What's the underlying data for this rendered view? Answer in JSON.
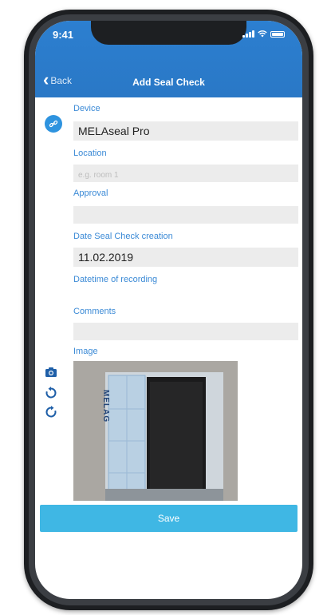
{
  "status_bar": {
    "time": "9:41"
  },
  "nav": {
    "back_label": "Back",
    "title": "Add Seal Check"
  },
  "form": {
    "device": {
      "label": "Device",
      "value": "MELAseal Pro"
    },
    "location": {
      "label": "Location",
      "placeholder": "e.g. room 1",
      "value": ""
    },
    "approval": {
      "label": "Approval",
      "value": ""
    },
    "date_seal_check": {
      "label": "Date Seal Check creation",
      "value": "11.02.2019"
    },
    "datetime_recording": {
      "label": "Datetime of recording",
      "value": ""
    },
    "comments": {
      "label": "Comments",
      "value": ""
    },
    "image": {
      "label": "Image",
      "strip_text": "MELAG"
    }
  },
  "icons": {
    "device": "link-icon",
    "camera": "camera-icon",
    "rotate_left": "rotate-ccw-icon",
    "rotate_right": "rotate-cw-icon"
  },
  "actions": {
    "save_label": "Save"
  },
  "colors": {
    "header": "#2a78c6",
    "label": "#3b8ad6",
    "save": "#3fb7e4",
    "input_bg": "#ececec"
  }
}
